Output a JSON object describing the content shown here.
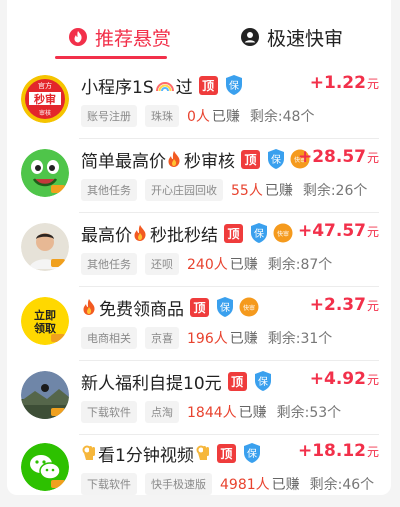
{
  "tabs": [
    {
      "label": "推荐悬赏",
      "active": true,
      "icon": "flame-icon"
    },
    {
      "label": "极速快审",
      "active": false,
      "icon": "user-circle-icon"
    }
  ],
  "colors": {
    "accent": "#f2304a",
    "top_badge": "#ef3c3c",
    "shield": "#3aa0ee",
    "fast": "#f59a1d"
  },
  "badge_top_label": "顶",
  "badge_shield_label": "保",
  "badge_fast_label": "快审",
  "unit_label": "元",
  "earned_suffix": "已赚",
  "tasks": [
    {
      "title": "小程序1S",
      "title_suffix": "过",
      "has_fire_prefix": false,
      "has_fire_mid": false,
      "rainbow": true,
      "reward": "+1.22",
      "tags": [
        "账号注册",
        "珠珠"
      ],
      "earned": "0人",
      "remain": "剩余:48个",
      "fast": false,
      "avatar": "seal",
      "avatar_text": {
        "top": "官方",
        "mid": "秒审",
        "side": "审核"
      }
    },
    {
      "title": "简单最高价",
      "title_suffix": "秒审核",
      "has_fire_prefix": false,
      "has_fire_mid": true,
      "rainbow": false,
      "reward": "+28.57",
      "tags": [
        "其他任务",
        "开心庄园回收"
      ],
      "earned": "55人",
      "remain": "剩余:26个",
      "fast": true,
      "avatar": "frog"
    },
    {
      "title": "最高价",
      "title_suffix": "秒批秒结",
      "has_fire_prefix": false,
      "has_fire_mid": true,
      "rainbow": false,
      "reward": "+47.57",
      "tags": [
        "其他任务",
        "还呗"
      ],
      "earned": "240人",
      "remain": "剩余:87个",
      "fast": true,
      "avatar": "person"
    },
    {
      "title": "",
      "title_suffix": "免费领商品",
      "has_fire_prefix": true,
      "has_fire_mid": false,
      "rainbow": false,
      "reward": "+2.37",
      "tags": [
        "电商相关",
        "京喜"
      ],
      "earned": "196人",
      "remain": "剩余:31个",
      "fast": true,
      "avatar": "yellow",
      "avatar_text": {
        "line1": "立即",
        "line2": "领取"
      }
    },
    {
      "title": "新人福利自提10元",
      "title_suffix": "",
      "has_fire_prefix": false,
      "has_fire_mid": false,
      "rainbow": false,
      "reward": "+4.92",
      "tags": [
        "下载软件",
        "点淘"
      ],
      "earned": "1844人",
      "remain": "剩余:53个",
      "fast": false,
      "avatar": "landscape"
    },
    {
      "title": "看1分钟视频",
      "title_suffix": "",
      "has_fire_prefix": false,
      "has_fire_mid": false,
      "rainbow": false,
      "ok_hand": true,
      "reward": "+18.12",
      "tags": [
        "下载软件",
        "快手极速版"
      ],
      "earned": "4981人",
      "remain": "剩余:46个",
      "fast": false,
      "avatar": "wechat"
    }
  ]
}
